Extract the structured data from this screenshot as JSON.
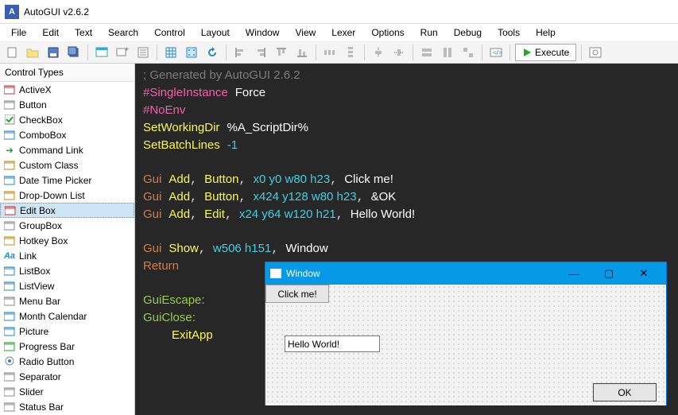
{
  "title": "AutoGUI v2.6.2",
  "menu": [
    "File",
    "Edit",
    "Text",
    "Search",
    "Control",
    "Layout",
    "Window",
    "View",
    "Lexer",
    "Options",
    "Run",
    "Debug",
    "Tools",
    "Help"
  ],
  "toolbar": {
    "execute_label": "Execute"
  },
  "sidebar": {
    "header": "Control Types",
    "items": [
      "ActiveX",
      "Button",
      "CheckBox",
      "ComboBox",
      "Command Link",
      "Custom Class",
      "Date Time Picker",
      "Drop-Down List",
      "Edit Box",
      "GroupBox",
      "Hotkey Box",
      "Link",
      "ListBox",
      "ListView",
      "Menu Bar",
      "Month Calendar",
      "Picture",
      "Progress Bar",
      "Radio Button",
      "Separator",
      "Slider",
      "Status Bar"
    ],
    "selected_index": 8
  },
  "code": {
    "l1_comment": "; Generated by AutoGUI 2.6.2",
    "l2_dir": "#SingleInstance",
    "l2_val": "Force",
    "l3_dir": "#NoEnv",
    "l4_cmd": "SetWorkingDir",
    "l4_val": "%A_ScriptDir%",
    "l5_cmd": "SetBatchLines",
    "l5_val": "-1",
    "l7a": "Gui",
    "l7b": "Add",
    "l7c": "Button",
    "l7d": "x0 y0 w80 h23",
    "l7e": "Click me!",
    "l8a": "Gui",
    "l8b": "Add",
    "l8c": "Button",
    "l8d": "x424 y128 w80 h23",
    "l8e": "&OK",
    "l9a": "Gui",
    "l9b": "Add",
    "l9c": "Edit",
    "l9d": "x24 y64 w120 h21",
    "l9e": "Hello World!",
    "l11a": "Gui",
    "l11b": "Show",
    "l11c": "w506 h151",
    "l11d": "Window",
    "l12": "Return",
    "l14": "GuiEscape:",
    "l15": "GuiClose:",
    "l16": "ExitApp"
  },
  "preview": {
    "title": "Window",
    "btn_click": "Click me!",
    "edit_value": "Hello World!",
    "btn_ok": "OK"
  }
}
